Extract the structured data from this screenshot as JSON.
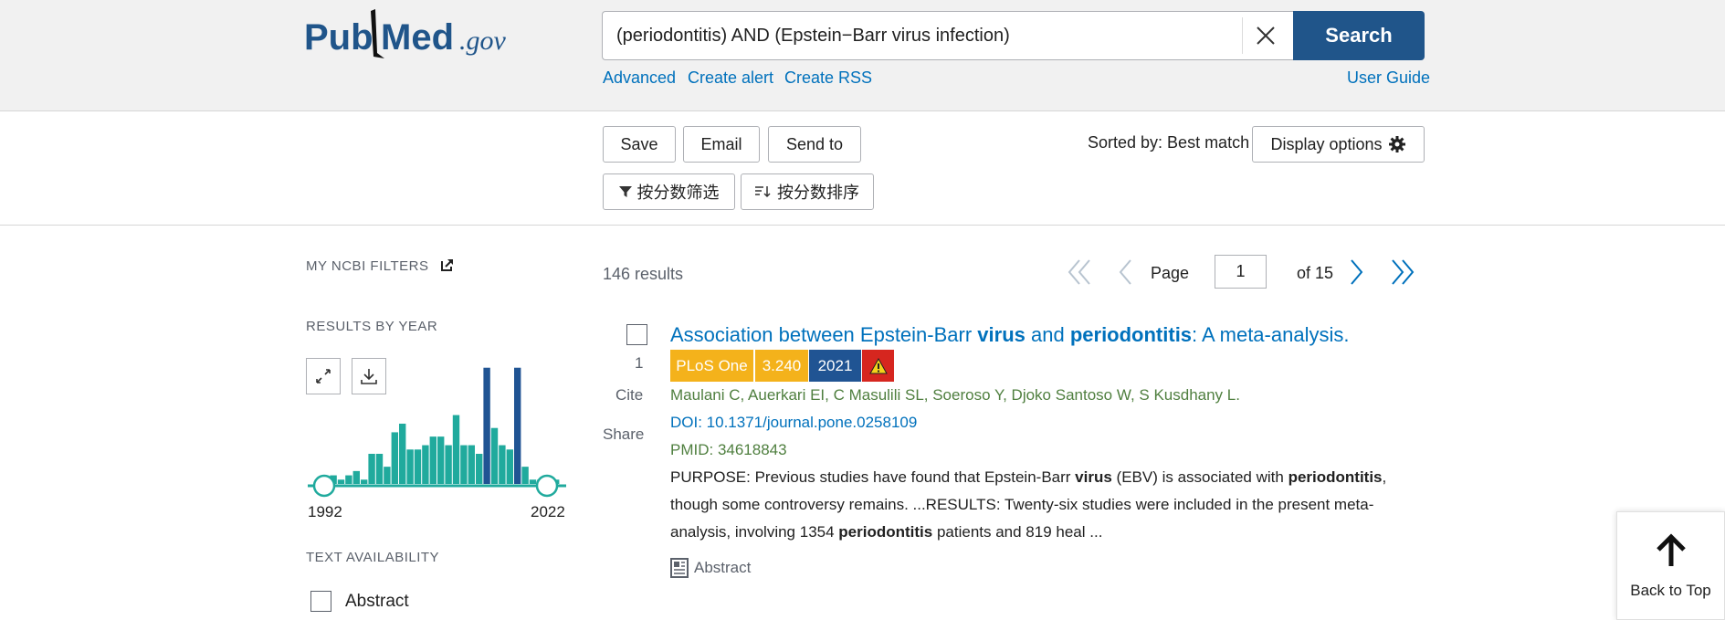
{
  "header": {
    "logo_pub": "Pub",
    "logo_med": "Med",
    "logo_gov": ".gov",
    "search_value": "(periodontitis) AND (Epstein−Barr virus infection)",
    "search_label": "Search",
    "advanced": "Advanced",
    "create_alert": "Create alert",
    "create_rss": "Create RSS",
    "user_guide": "User Guide"
  },
  "actions": {
    "save": "Save",
    "email": "Email",
    "send_to": "Send to",
    "sorted_by": "Sorted by: Best match",
    "display_options": "Display options",
    "filter_by_score": "按分数筛选",
    "sort_by_score": "按分数排序"
  },
  "sidebar": {
    "my_ncbi_filters": "MY NCBI FILTERS",
    "results_by_year": "RESULTS BY YEAR",
    "year_start": "1992",
    "year_end": "2022",
    "text_availability": "TEXT AVAILABILITY",
    "abstract_filter": "Abstract"
  },
  "chart_data": {
    "type": "bar",
    "title": "RESULTS BY YEAR",
    "categories": [
      "1992",
      "1993",
      "1994",
      "1995",
      "1996",
      "1997",
      "1998",
      "1999",
      "2000",
      "2001",
      "2002",
      "2003",
      "2004",
      "2005",
      "2006",
      "2007",
      "2008",
      "2009",
      "2010",
      "2011",
      "2012",
      "2013",
      "2014",
      "2015",
      "2016",
      "2017",
      "2018",
      "2019",
      "2020",
      "2021",
      "2022"
    ],
    "values": [
      1,
      2,
      1,
      2,
      3,
      1,
      7,
      7,
      4,
      12,
      14,
      8,
      8,
      9,
      11,
      11,
      9,
      16,
      9,
      9,
      7,
      27,
      13,
      9,
      8,
      27,
      4,
      1,
      1,
      1,
      1
    ],
    "highlight_color": "#205493",
    "bar_color": "#20aa9d",
    "ylim": [
      0,
      28
    ]
  },
  "results": {
    "count": "146 results",
    "page_label": "Page",
    "page_value": "1",
    "page_of": "of 15"
  },
  "result1": {
    "checkbox_number": "1",
    "cite": "Cite",
    "share": "Share",
    "title_1": "Association between Epstein-Barr ",
    "title_2": "virus",
    "title_3": " and ",
    "title_4": "periodontitis",
    "title_5": ": A meta-analysis.",
    "journal": "PLoS One",
    "impact": "3.240",
    "year": "2021",
    "authors": "Maulani C, Auerkari EI, C Masulili SL, Soeroso Y, Djoko Santoso W, S Kusdhany L.",
    "doi": "DOI: 10.1371/journal.pone.0258109",
    "pmid": "PMID: 34618843",
    "snip_1": "PURPOSE: Previous studies have found that Epstein-Barr ",
    "snip_2": "virus",
    "snip_3": " (EBV) is associated with ",
    "snip_4": "periodontitis",
    "snip_5": ", though some controversy remains. ...RESULTS: Twenty-six studies were included in the present meta-analysis, involving 1354 ",
    "snip_6": "periodontitis",
    "snip_7": " patients and 819 heal ...",
    "abstract_link": "Abstract"
  },
  "back_to_top": "Back to Top",
  "colors": {
    "link": "#0071bc",
    "search_button": "#20558a",
    "journal_badge": "#f4b21b",
    "impact_badge": "#f4b21b",
    "year_badge": "#205493",
    "warning_badge": "#d6261f",
    "meta_green": "#4f7f3f"
  }
}
